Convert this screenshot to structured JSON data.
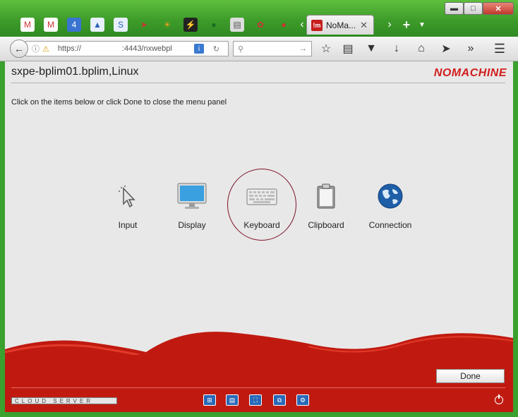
{
  "browser": {
    "tab": {
      "title": "NoMa...",
      "favicon_text": "!m"
    },
    "url": {
      "scheme": "https://",
      "rest": ":4443/nxwebpl"
    },
    "window_controls": [
      "minimize",
      "maximize",
      "close"
    ]
  },
  "app": {
    "title": "sxpe-bplim01.bplim,Linux",
    "brand": "NOMACHINE",
    "instructions": "Click on the items below or click Done to close the menu panel",
    "items": [
      {
        "label": "Input",
        "icon": "cursor-icon"
      },
      {
        "label": "Display",
        "icon": "monitor-icon"
      },
      {
        "label": "Keyboard",
        "icon": "keyboard-icon"
      },
      {
        "label": "Clipboard",
        "icon": "clipboard-icon"
      },
      {
        "label": "Connection",
        "icon": "globe-icon"
      }
    ],
    "done_label": "Done",
    "footer_logo": "CLOUD SERVER"
  },
  "colors": {
    "accent_red": "#c01a10",
    "brand_red": "#d11e1e",
    "chrome_green": "#3e9c2a"
  }
}
